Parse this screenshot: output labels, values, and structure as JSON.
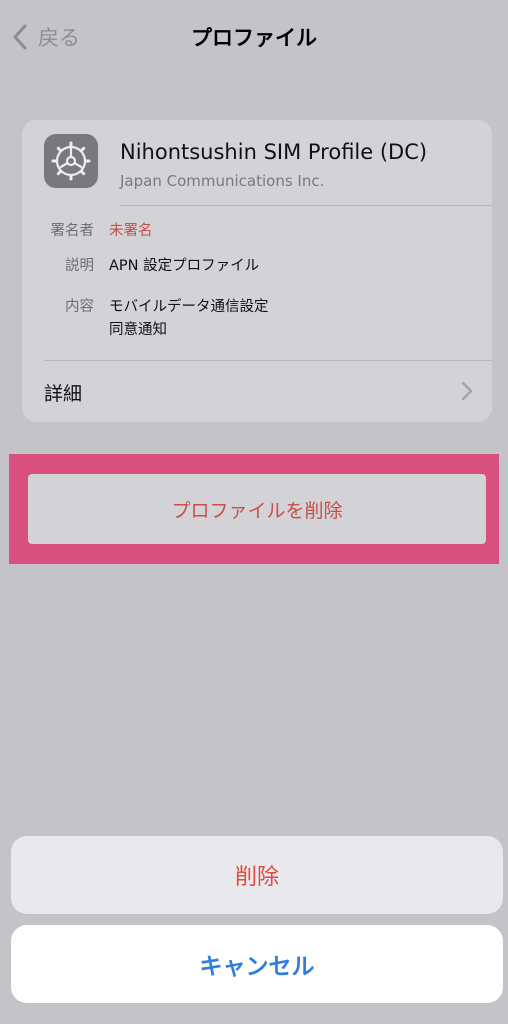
{
  "nav": {
    "back_label": "戻る",
    "title": "プロファイル"
  },
  "profile": {
    "name": "Nihontsushin SIM Profile (DC)",
    "organization": "Japan Communications Inc.",
    "icon": "gear-icon",
    "fields": [
      {
        "key": "署名者",
        "value": "未署名"
      },
      {
        "key": "説明",
        "value": "APN 設定プロファイル"
      },
      {
        "key": "内容",
        "value_lines": [
          "モバイルデータ通信設定",
          "同意通知"
        ]
      }
    ],
    "details_label": "詳細"
  },
  "actions": {
    "remove_profile_label": "プロファイルを削除"
  },
  "sheet": {
    "delete_label": "削除",
    "cancel_label": "キャンセル"
  },
  "colors": {
    "background": "#c4c3c8",
    "destructive": "#e0493c",
    "accent": "#2f7de1",
    "highlight": "#d8507e"
  }
}
